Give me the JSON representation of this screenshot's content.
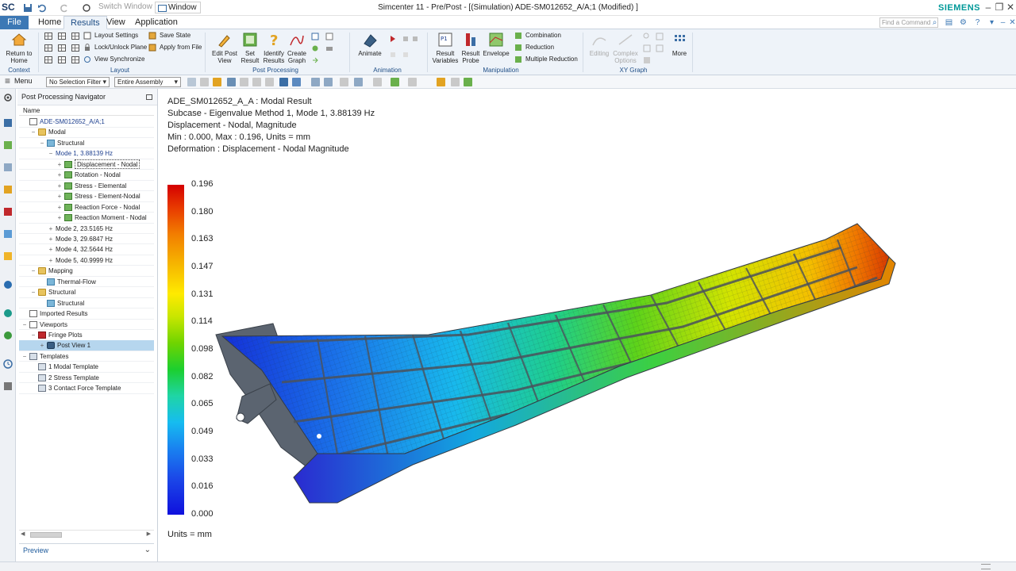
{
  "titlebar": {
    "logo": "SC",
    "switch_window": "Switch Window",
    "window_menu": "Window",
    "title": "Simcenter 11 - Pre/Post - [(Simulation) ADE-SM012652_A/A;1 (Modified) ]",
    "brand": "SIEMENS"
  },
  "tabs": {
    "file": "File",
    "items": [
      "Home",
      "Results",
      "View",
      "Application"
    ],
    "active": "Results",
    "find_placeholder": "Find a Command"
  },
  "ribbon": {
    "context": {
      "button_line1": "Return to",
      "button_line2": "Home",
      "label": "Context"
    },
    "layout": {
      "label": "Layout",
      "items": [
        "Layout Settings",
        "Lock/Unlock Plane",
        "View Synchronize"
      ],
      "state_items": [
        "Save State",
        "Apply from File"
      ]
    },
    "post_processing": {
      "label": "Post Processing",
      "buttons": [
        {
          "line1": "Edit Post",
          "line2": "View"
        },
        {
          "line1": "Set",
          "line2": "Result"
        },
        {
          "line1": "Identify",
          "line2": "Results"
        },
        {
          "line1": "Create",
          "line2": "Graph"
        }
      ]
    },
    "animation": {
      "label": "Animation",
      "button": "Animate"
    },
    "manipulation": {
      "label": "Manipulation",
      "buttons": [
        {
          "line1": "Result",
          "line2": "Variables"
        },
        {
          "line1": "Result",
          "line2": "Probe"
        },
        {
          "line1": "Envelope",
          "line2": ""
        }
      ],
      "items": [
        "Combination",
        "Reduction",
        "Multiple Reduction"
      ]
    },
    "xy_graph": {
      "label": "XY Graph",
      "buttons": [
        {
          "line1": "Editing",
          "line2": ""
        },
        {
          "line1": "Complex",
          "line2": "Options"
        }
      ],
      "more": "More"
    }
  },
  "selbar": {
    "menu": "Menu",
    "filter": "No Selection Filter",
    "scope": "Entire Assembly"
  },
  "navigator": {
    "title": "Post Processing Navigator",
    "column": "Name",
    "preview": "Preview",
    "tree": [
      {
        "label": "ADE-SM012652_A/A;1",
        "indent": 0,
        "icon": "doc",
        "exp": "",
        "style": "blue"
      },
      {
        "label": "Modal",
        "indent": 1,
        "icon": "folder",
        "exp": "−"
      },
      {
        "label": "Structural",
        "indent": 2,
        "icon": "struct",
        "exp": "−"
      },
      {
        "label": "Mode 1, 3.88139 Hz",
        "indent": 3,
        "icon": "",
        "exp": "−",
        "style": "blue"
      },
      {
        "label": "Displacement - Nodal",
        "indent": 4,
        "icon": "green",
        "exp": "+",
        "style": "boxed"
      },
      {
        "label": "Rotation - Nodal",
        "indent": 4,
        "icon": "green",
        "exp": "+"
      },
      {
        "label": "Stress - Elemental",
        "indent": 4,
        "icon": "green",
        "exp": "+"
      },
      {
        "label": "Stress - Element-Nodal",
        "indent": 4,
        "icon": "green",
        "exp": "+"
      },
      {
        "label": "Reaction Force - Nodal",
        "indent": 4,
        "icon": "green",
        "exp": "+"
      },
      {
        "label": "Reaction Moment - Nodal",
        "indent": 4,
        "icon": "green",
        "exp": "+"
      },
      {
        "label": "Mode 2, 23.5165 Hz",
        "indent": 3,
        "icon": "",
        "exp": "+"
      },
      {
        "label": "Mode 3, 29.6847 Hz",
        "indent": 3,
        "icon": "",
        "exp": "+"
      },
      {
        "label": "Mode 4, 32.5644 Hz",
        "indent": 3,
        "icon": "",
        "exp": "+"
      },
      {
        "label": "Mode 5, 40.9999 Hz",
        "indent": 3,
        "icon": "",
        "exp": "+"
      },
      {
        "label": "Mapping",
        "indent": 1,
        "icon": "folder",
        "exp": "−"
      },
      {
        "label": "Thermal-Flow",
        "indent": 2,
        "icon": "struct",
        "exp": ""
      },
      {
        "label": "Structural",
        "indent": 1,
        "icon": "folder",
        "exp": "−"
      },
      {
        "label": "Structural",
        "indent": 2,
        "icon": "struct",
        "exp": ""
      },
      {
        "label": "Imported Results",
        "indent": 0,
        "icon": "doc",
        "exp": ""
      },
      {
        "label": "Viewports",
        "indent": 0,
        "icon": "doc",
        "exp": "−"
      },
      {
        "label": "Fringe Plots",
        "indent": 1,
        "icon": "red",
        "exp": "−"
      },
      {
        "label": "Post View 1",
        "indent": 2,
        "icon": "cam",
        "exp": "+",
        "style": "sel"
      },
      {
        "label": "Templates",
        "indent": 0,
        "icon": "tmpl",
        "exp": "−"
      },
      {
        "label": "1 Modal Template",
        "indent": 1,
        "icon": "tmpl",
        "exp": ""
      },
      {
        "label": "2 Stress Template",
        "indent": 1,
        "icon": "tmpl",
        "exp": ""
      },
      {
        "label": "3 Contact Force Template",
        "indent": 1,
        "icon": "tmpl",
        "exp": ""
      }
    ]
  },
  "viewport": {
    "header": [
      "ADE_SM012652_A_A : Modal Result",
      "Subcase - Eigenvalue Method 1, Mode 1, 3.88139 Hz",
      "Displacement - Nodal, Magnitude",
      "Min : 0.000, Max : 0.196, Units = mm",
      "Deformation : Displacement - Nodal Magnitude"
    ],
    "legend_values": [
      "0.196",
      "0.180",
      "0.163",
      "0.147",
      "0.131",
      "0.114",
      "0.098",
      "0.082",
      "0.065",
      "0.049",
      "0.033",
      "0.016",
      "0.000"
    ],
    "units": "Units = mm"
  },
  "colors": {
    "accent": "#3c78b5",
    "ribbon_bg": "#eef3f9",
    "selection": "#b6d6ee",
    "siemens": "#009999"
  }
}
